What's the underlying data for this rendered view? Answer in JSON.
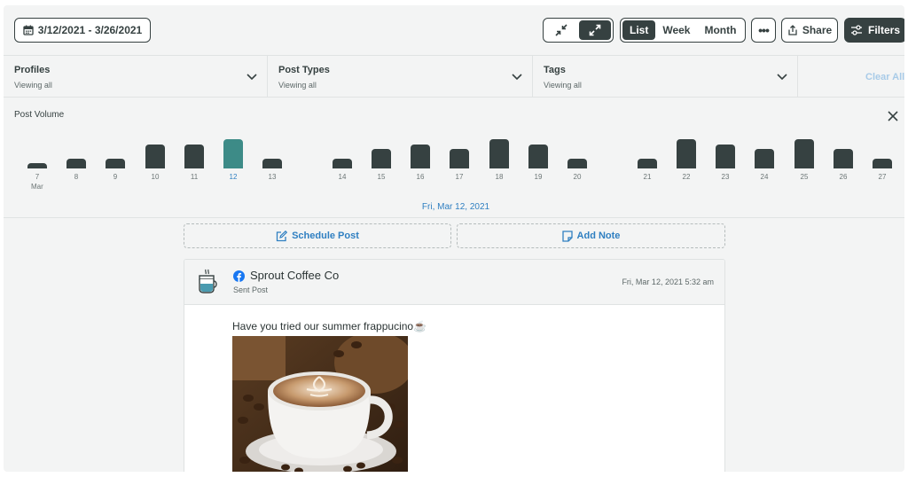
{
  "toolbar": {
    "date_range": "3/12/2021 - 3/26/2021",
    "view_options": [
      "List",
      "Week",
      "Month"
    ],
    "active_view": "List",
    "more_label": "•••",
    "share_label": "Share",
    "filters_label": "Filters"
  },
  "filters": {
    "items": [
      {
        "title": "Profiles",
        "subtitle": "Viewing all"
      },
      {
        "title": "Post Types",
        "subtitle": "Viewing all"
      },
      {
        "title": "Tags",
        "subtitle": "Viewing all"
      }
    ],
    "clear_all": "Clear All"
  },
  "post_volume": {
    "title": "Post Volume",
    "month_label": "Mar",
    "selected_date": "Fri, Mar 12, 2021"
  },
  "chart_data": {
    "type": "bar",
    "title": "Post Volume",
    "categories": [
      "7",
      "8",
      "9",
      "10",
      "11",
      "12",
      "13",
      "14",
      "15",
      "16",
      "17",
      "18",
      "19",
      "20",
      "21",
      "22",
      "23",
      "24",
      "25",
      "26",
      "27"
    ],
    "values": [
      1,
      2,
      2,
      5,
      5,
      6,
      2,
      2,
      4,
      5,
      4,
      6,
      5,
      2,
      2,
      6,
      5,
      4,
      6,
      4,
      2
    ],
    "selected_category": "12",
    "colors": {
      "bar": "#364141",
      "selected": "#3d8b87"
    }
  },
  "actions": {
    "schedule_label": "Schedule Post",
    "note_label": "Add Note"
  },
  "post": {
    "account": "Sprout Coffee Co",
    "status": "Sent Post",
    "timestamp": "Fri, Mar 12, 2021 5:32 am",
    "text": "Have you tried our summer frappucino☕"
  },
  "colors": {
    "accent": "#2f7fc1",
    "dark": "#364141",
    "teal": "#3d8b87",
    "facebook": "#1877f2"
  }
}
